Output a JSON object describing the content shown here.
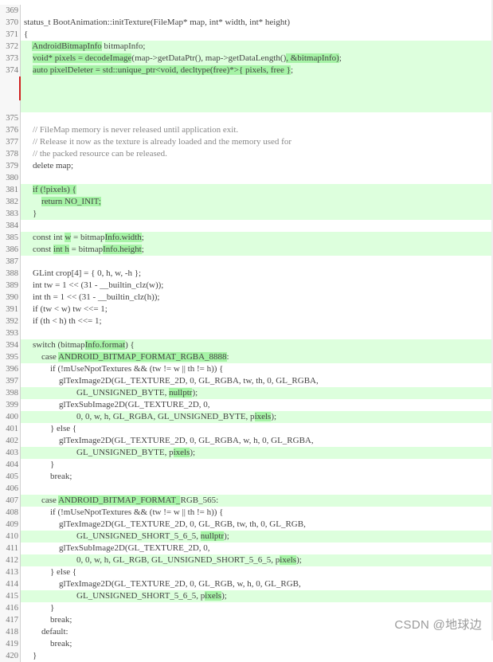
{
  "lines": [
    {
      "n": "369",
      "text": "",
      "type": "ctx"
    },
    {
      "n": "370",
      "text": "status_t BootAnimation::initTexture(FileMap* map, int* width, int* height)",
      "type": "ctx"
    },
    {
      "n": "371",
      "text": "{",
      "type": "ctx"
    },
    {
      "n": "372",
      "text": "    AndroidBitmapInfo bitmapInfo;",
      "type": "add"
    },
    {
      "n": "373",
      "text": "    void* pixels = decodeImage(map->getDataPtr(), map->getDataLength(), &bitmapInfo);",
      "type": "add"
    },
    {
      "n": "374",
      "text": "    auto pixelDeleter = std::unique_ptr<void, decltype(free)*>{ pixels, free };",
      "type": "add"
    },
    {
      "n": "",
      "text": "",
      "type": "add-blank",
      "marked": true
    },
    {
      "n": "",
      "text": "",
      "type": "add-blank",
      "marked": true
    },
    {
      "n": "",
      "text": "",
      "type": "add-blank"
    },
    {
      "n": "375",
      "text": "",
      "type": "ctx"
    },
    {
      "n": "376",
      "text": "    // FileMap memory is never released until application exit.",
      "type": "ctx"
    },
    {
      "n": "377",
      "text": "    // Release it now as the texture is already loaded and the memory used for",
      "type": "ctx"
    },
    {
      "n": "378",
      "text": "    // the packed resource can be released.",
      "type": "ctx"
    },
    {
      "n": "379",
      "text": "    delete map;",
      "type": "ctx"
    },
    {
      "n": "380",
      "text": "",
      "type": "ctx"
    },
    {
      "n": "381",
      "text": "    if (!pixels) {",
      "type": "add"
    },
    {
      "n": "382",
      "text": "        return NO_INIT;",
      "type": "add"
    },
    {
      "n": "383",
      "text": "    }",
      "type": "add"
    },
    {
      "n": "384",
      "text": "",
      "type": "ctx"
    },
    {
      "n": "385",
      "text": "    const int w = bitmapInfo.width;",
      "type": "add"
    },
    {
      "n": "386",
      "text": "    const int h = bitmapInfo.height;",
      "type": "add"
    },
    {
      "n": "387",
      "text": "",
      "type": "ctx"
    },
    {
      "n": "388",
      "text": "    GLint crop[4] = { 0, h, w, -h };",
      "type": "ctx"
    },
    {
      "n": "389",
      "text": "    int tw = 1 << (31 - __builtin_clz(w));",
      "type": "ctx"
    },
    {
      "n": "390",
      "text": "    int th = 1 << (31 - __builtin_clz(h));",
      "type": "ctx"
    },
    {
      "n": "391",
      "text": "    if (tw < w) tw <<= 1;",
      "type": "ctx"
    },
    {
      "n": "392",
      "text": "    if (th < h) th <<= 1;",
      "type": "ctx"
    },
    {
      "n": "393",
      "text": "",
      "type": "ctx"
    },
    {
      "n": "394",
      "text": "    switch (bitmapInfo.format) {",
      "type": "add"
    },
    {
      "n": "395",
      "text": "        case ANDROID_BITMAP_FORMAT_RGBA_8888:",
      "type": "add"
    },
    {
      "n": "396",
      "text": "            if (!mUseNpotTextures && (tw != w || th != h)) {",
      "type": "ctx"
    },
    {
      "n": "397",
      "text": "                glTexImage2D(GL_TEXTURE_2D, 0, GL_RGBA, tw, th, 0, GL_RGBA,",
      "type": "ctx"
    },
    {
      "n": "398",
      "text": "                        GL_UNSIGNED_BYTE, nullptr);",
      "type": "add"
    },
    {
      "n": "399",
      "text": "                glTexSubImage2D(GL_TEXTURE_2D, 0,",
      "type": "ctx"
    },
    {
      "n": "400",
      "text": "                        0, 0, w, h, GL_RGBA, GL_UNSIGNED_BYTE, pixels);",
      "type": "add"
    },
    {
      "n": "401",
      "text": "            } else {",
      "type": "ctx"
    },
    {
      "n": "402",
      "text": "                glTexImage2D(GL_TEXTURE_2D, 0, GL_RGBA, w, h, 0, GL_RGBA,",
      "type": "ctx"
    },
    {
      "n": "403",
      "text": "                        GL_UNSIGNED_BYTE, pixels);",
      "type": "add"
    },
    {
      "n": "404",
      "text": "            }",
      "type": "ctx"
    },
    {
      "n": "405",
      "text": "            break;",
      "type": "ctx"
    },
    {
      "n": "406",
      "text": "",
      "type": "ctx"
    },
    {
      "n": "407",
      "text": "        case ANDROID_BITMAP_FORMAT_RGB_565:",
      "type": "add"
    },
    {
      "n": "408",
      "text": "            if (!mUseNpotTextures && (tw != w || th != h)) {",
      "type": "ctx"
    },
    {
      "n": "409",
      "text": "                glTexImage2D(GL_TEXTURE_2D, 0, GL_RGB, tw, th, 0, GL_RGB,",
      "type": "ctx"
    },
    {
      "n": "410",
      "text": "                        GL_UNSIGNED_SHORT_5_6_5, nullptr);",
      "type": "add"
    },
    {
      "n": "411",
      "text": "                glTexSubImage2D(GL_TEXTURE_2D, 0,",
      "type": "ctx"
    },
    {
      "n": "412",
      "text": "                        0, 0, w, h, GL_RGB, GL_UNSIGNED_SHORT_5_6_5, pixels);",
      "type": "add"
    },
    {
      "n": "413",
      "text": "            } else {",
      "type": "ctx"
    },
    {
      "n": "414",
      "text": "                glTexImage2D(GL_TEXTURE_2D, 0, GL_RGB, w, h, 0, GL_RGB,",
      "type": "ctx"
    },
    {
      "n": "415",
      "text": "                        GL_UNSIGNED_SHORT_5_6_5, pixels);",
      "type": "add"
    },
    {
      "n": "416",
      "text": "            }",
      "type": "ctx"
    },
    {
      "n": "417",
      "text": "            break;",
      "type": "ctx"
    },
    {
      "n": "418",
      "text": "        default:",
      "type": "ctx"
    },
    {
      "n": "419",
      "text": "            break;",
      "type": "ctx"
    },
    {
      "n": "420",
      "text": "    }",
      "type": "ctx"
    }
  ],
  "highlights": [
    {
      "line": "372",
      "parts": [
        "AndroidBitmap",
        "Info"
      ]
    },
    {
      "line": "373",
      "parts": [
        "void* pixels = decodeImage",
        ", &bitmapInfo)"
      ]
    },
    {
      "line": "374",
      "parts": [
        "auto pixelDeleter = std::unique_ptr<void, decltype(free)*>{ pixels, free }"
      ]
    },
    {
      "line": "381",
      "parts": [
        "if (!pixels) {"
      ]
    },
    {
      "line": "382",
      "parts": [
        "return NO_INIT;"
      ]
    },
    {
      "line": "385",
      "parts": [
        "w",
        "Info.width"
      ]
    },
    {
      "line": "386",
      "parts": [
        "int h",
        "Info.height"
      ]
    },
    {
      "line": "394",
      "parts": [
        "Info.format"
      ]
    },
    {
      "line": "395",
      "parts": [
        "ANDROID_BITMAP_FORMAT_RGBA_8888"
      ]
    },
    {
      "line": "398",
      "parts": [
        "nullptr"
      ]
    },
    {
      "line": "400",
      "parts": [
        "ixels"
      ]
    },
    {
      "line": "403",
      "parts": [
        "ixels"
      ]
    },
    {
      "line": "407",
      "parts": [
        "ANDROID_BITMAP_FORMAT_"
      ]
    },
    {
      "line": "410",
      "parts": [
        "nullptr"
      ]
    },
    {
      "line": "412",
      "parts": [
        "ixels"
      ]
    },
    {
      "line": "415",
      "parts": [
        "ixels"
      ]
    }
  ],
  "watermark": "CSDN @地球边",
  "colors": {
    "added_bg": "#ddffdd",
    "highlight": "#a6f3a6",
    "marker": "#d02020"
  }
}
